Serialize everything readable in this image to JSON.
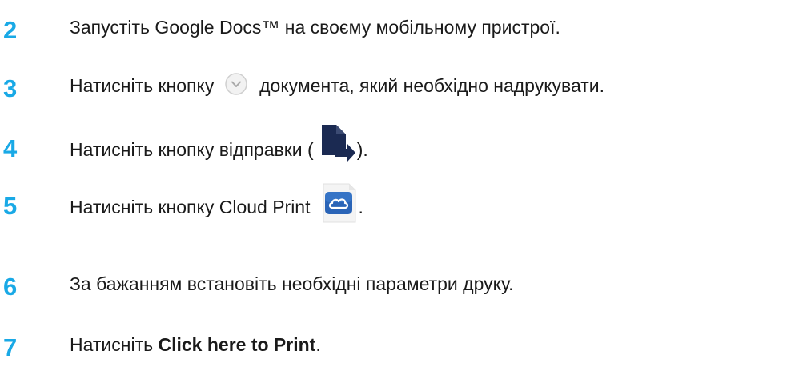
{
  "steps": [
    {
      "number": "2",
      "text": "Запустіть Google Docs™ на своєму мобільному пристрої."
    },
    {
      "number": "3",
      "text_before": "Натисніть кнопку",
      "icon": "dropdown-circle-icon",
      "text_after": "документа, який необхідно надрукувати."
    },
    {
      "number": "4",
      "text_before": "Натисніть кнопку відправки (",
      "icon": "send-document-icon",
      "text_after": ")."
    },
    {
      "number": "5",
      "text_before": "Натисніть кнопку Cloud Print",
      "icon": "cloud-print-icon",
      "text_after": "."
    },
    {
      "number": "6",
      "text": "За бажанням встановіть необхідні параметри друку."
    },
    {
      "number": "7",
      "text_before": "Натисніть ",
      "bold_text": "Click here to Print",
      "text_after": "."
    }
  ],
  "colors": {
    "step_number": "#19a9e6",
    "send_icon": "#1b2a52",
    "cloud_icon": "#2a64b7",
    "dropdown_icon": "#c8c8c8"
  }
}
